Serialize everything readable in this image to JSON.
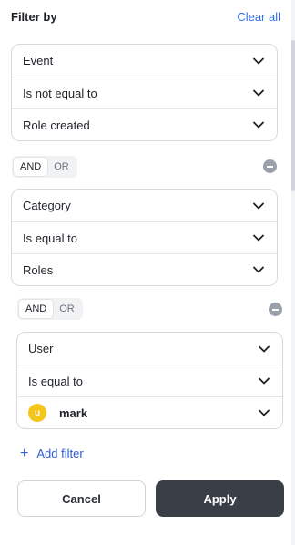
{
  "header": {
    "title": "Filter by",
    "clear_label": "Clear all"
  },
  "groups": [
    {
      "rows": [
        "Event",
        "Is not equal to",
        "Role created"
      ]
    },
    {
      "rows": [
        "Category",
        "Is equal to",
        "Roles"
      ]
    },
    {
      "rows": [
        "User",
        "Is equal to"
      ],
      "user": {
        "initial": "u",
        "name": "mark"
      }
    }
  ],
  "logic_toggles": [
    {
      "and": "AND",
      "or": "OR",
      "selected": "AND"
    },
    {
      "and": "AND",
      "or": "OR",
      "selected": "AND"
    }
  ],
  "add_filter": {
    "label": "Add filter",
    "icon": "plus-icon"
  },
  "buttons": {
    "cancel": "Cancel",
    "apply": "Apply"
  },
  "colors": {
    "link": "#2f6feb",
    "apply_bg": "#3a3f47",
    "avatar": "#f5c518",
    "remove_icon": "#9aa1ab"
  }
}
